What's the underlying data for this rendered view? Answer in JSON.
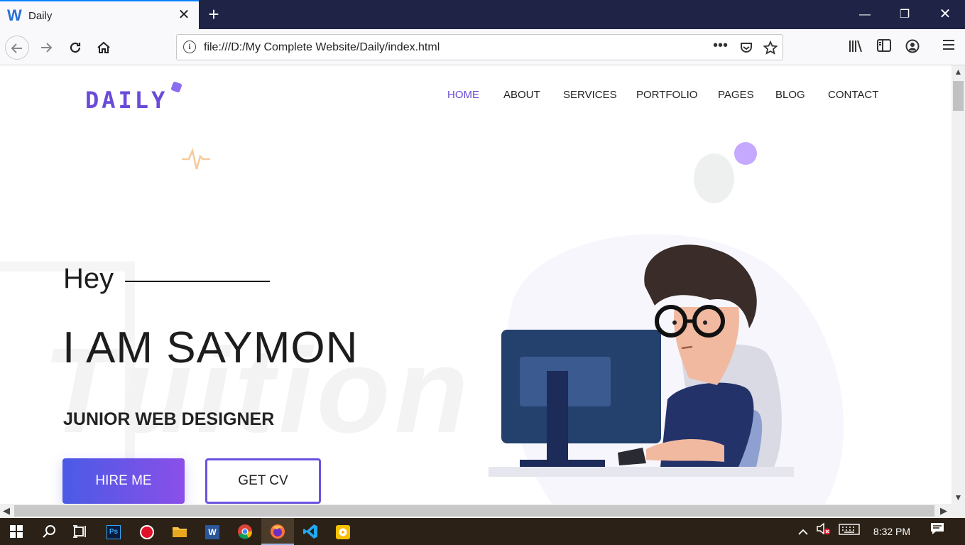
{
  "browser": {
    "tab_favicon": "W",
    "tab_title": "Daily",
    "tab_close": "✕",
    "new_tab": "+",
    "url": "file:///D:/My Complete Website/Daily/index.html",
    "page_actions": "•••",
    "window_minimize": "—",
    "window_restore": "❐",
    "window_close": "✕"
  },
  "site": {
    "logo": "DAILY",
    "nav": [
      "HOME",
      "ABOUT",
      "SERVICES",
      "PORTFOLIO",
      "PAGES",
      "BLOG",
      "CONTACT"
    ],
    "active_nav": "HOME",
    "greeting": "Hey",
    "headline": "I AM SAYMON",
    "role": "JUNIOR WEB DESIGNER",
    "hire_button": "HIRE ME",
    "cv_button": "GET CV",
    "watermark": "Tuition"
  },
  "taskbar": {
    "time": "8:32 PM",
    "apps": [
      "windows-start",
      "search",
      "task-view",
      "photoshop",
      "recorder",
      "file-explorer",
      "word",
      "chrome",
      "firefox",
      "vscode",
      "media-player"
    ],
    "active_app": "firefox"
  },
  "colors": {
    "accent": "#6a4bd8",
    "tab_strip": "#1f2447",
    "taskbar": "#2b2116"
  }
}
